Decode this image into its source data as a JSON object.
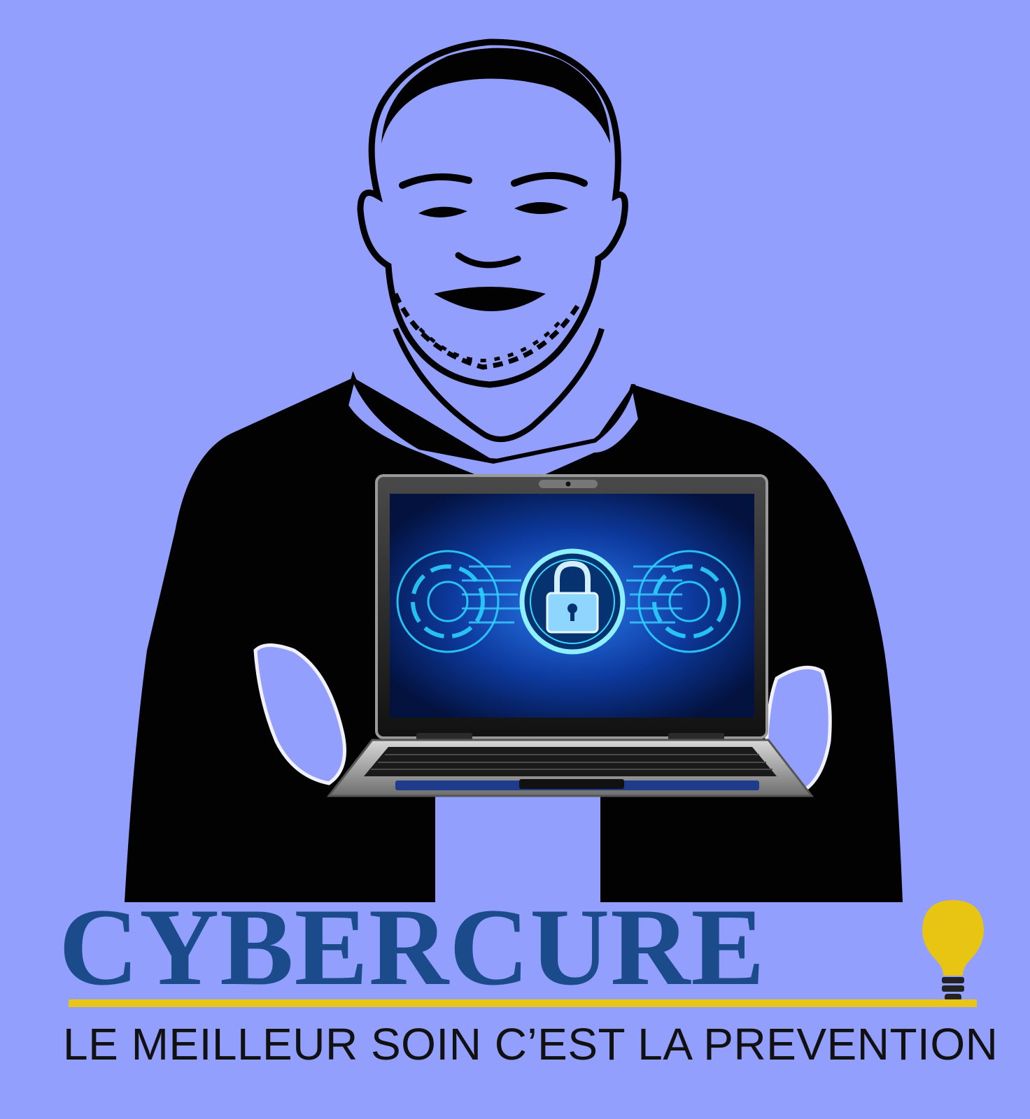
{
  "brand": {
    "name": "CYBERCURE",
    "tagline": "LE MEILLEUR SOIN C’EST LA PREVENTION",
    "icon": "lightbulb-icon"
  },
  "illustration": {
    "subject": "person-holding-laptop",
    "screen_icon": "padlock-icon"
  },
  "colors": {
    "background": "#929ffd",
    "brand_blue": "#1c4b8c",
    "accent_yellow": "#e9c517",
    "tagline_text": "#111111"
  }
}
